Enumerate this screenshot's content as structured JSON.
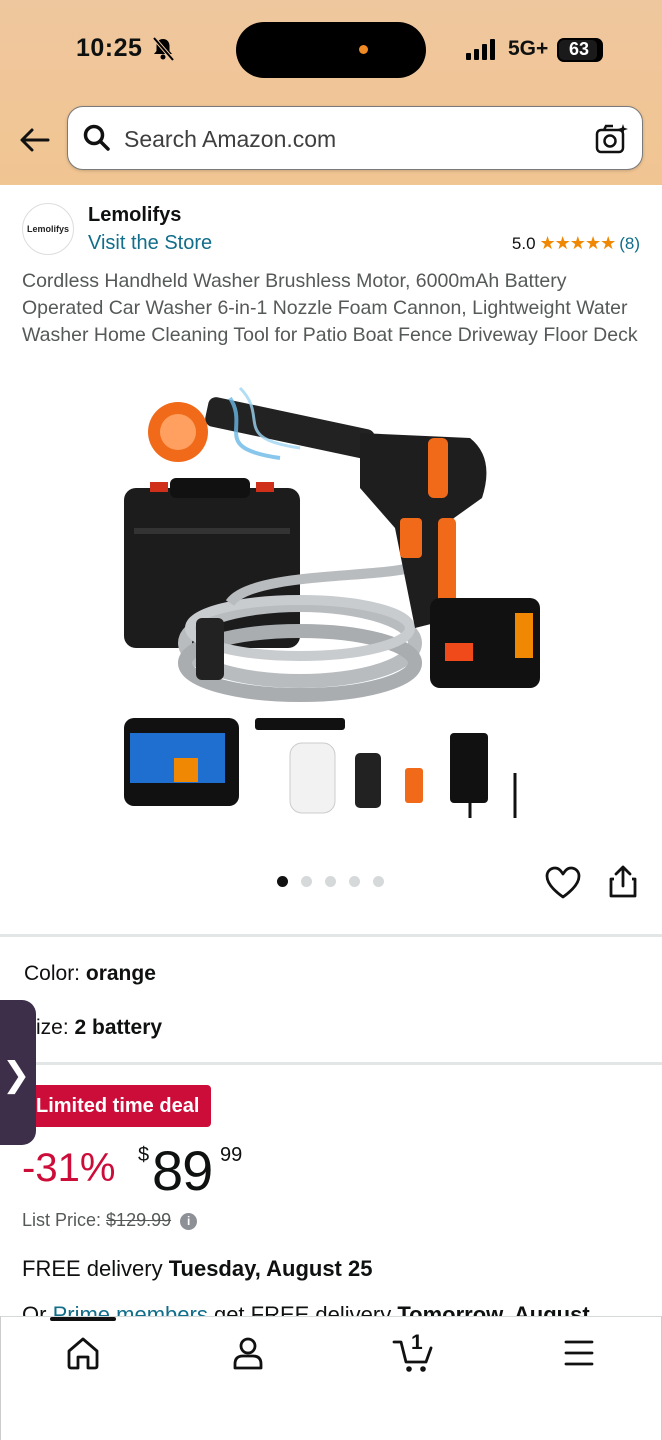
{
  "status_bar": {
    "time": "10:25",
    "network": "5G+",
    "battery": "63"
  },
  "search": {
    "placeholder": "Search Amazon.com"
  },
  "store": {
    "logo_text": "Lemolifys",
    "name": "Lemolifys",
    "link": "Visit the Store",
    "rating": "5.0",
    "stars": "★★★★★",
    "rating_count": "(8)"
  },
  "product": {
    "title": "Cordless Handheld Washer Brushless Motor, 6000mAh Battery Operated Car Washer 6-in-1 Nozzle Foam Cannon, Lightweight Water Washer Home Cleaning Tool for Patio Boat Fence Driveway Floor Deck",
    "image_count": 5,
    "active_image": 0
  },
  "variants": {
    "color_label": "Color:",
    "color_value": "orange",
    "size_label": "ize:",
    "size_value": "2 battery"
  },
  "pricing": {
    "deal_badge": "Limited time deal",
    "discount": "-31%",
    "currency": "$",
    "whole": "89",
    "fraction": "99",
    "list_label": "List Price:",
    "list_value": "$129.99"
  },
  "delivery": {
    "prefix": "FREE delivery",
    "date": "Tuesday, August 25",
    "prime_prefix": "Or",
    "prime_link": "Prime members",
    "prime_middle": "get FREE delivery",
    "prime_date": "Tomorrow, August"
  },
  "bottom_nav": {
    "cart_count": "1"
  },
  "colors": {
    "accent": "#f08804",
    "link": "#116e8a",
    "deal": "#cc0c39",
    "header": "#efc79e"
  }
}
